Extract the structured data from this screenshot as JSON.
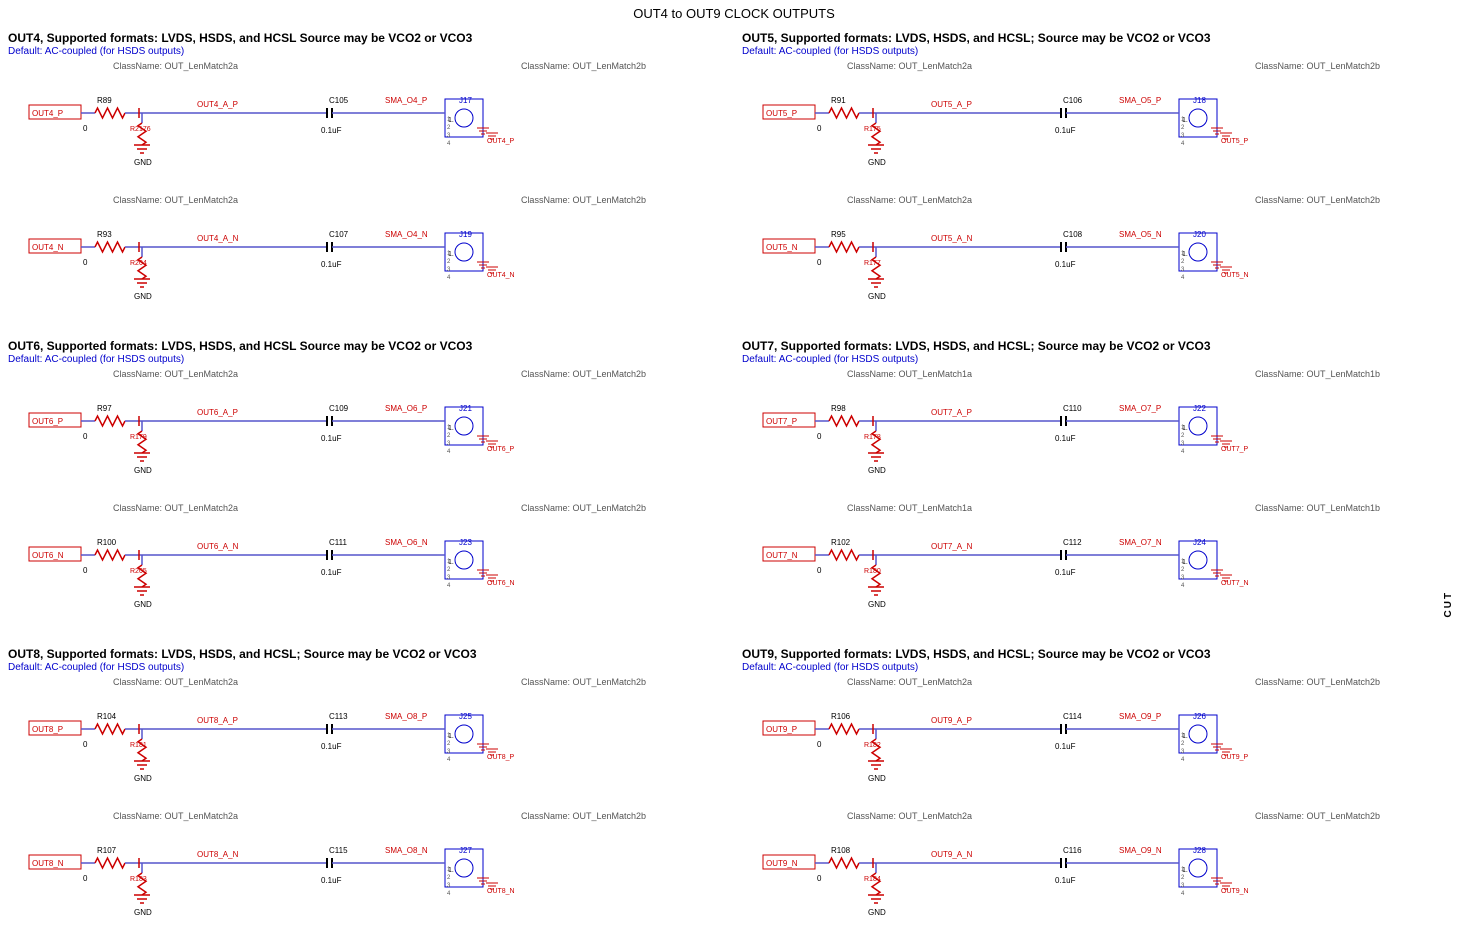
{
  "page": {
    "title": "OUT4 to OUT9 CLOCK OUTPUTS"
  },
  "sections": [
    {
      "id": "out4",
      "title": "OUT4, Supported  formats:  LVDS, HSDS, and HCSL Source  may be VCO2 or VCO3",
      "subtitle": "Default:  AC-coupled  (for HSDS outputs)",
      "circuits": [
        {
          "classLeft": "ClassName: OUT_LenMatch2a",
          "classRight": "ClassName: OUT_LenMatch2b",
          "net_in": "OUT4_P",
          "resistor1": "R89",
          "resistor2_label": "R2176",
          "net_mid": "OUT4_A_P",
          "cap": "C105",
          "cap_val": "0.1uF",
          "sma": "SMA_O4_P",
          "connector": "J17",
          "gnd": true
        },
        {
          "classLeft": "ClassName: OUT_LenMatch2a",
          "classRight": "ClassName: OUT_LenMatch2b",
          "net_in": "OUT4_N",
          "resistor1": "R93",
          "resistor2_label": "R204",
          "net_mid": "OUT4_A_N",
          "cap": "C107",
          "cap_val": "0.1uF",
          "sma": "SMA_O4_N",
          "connector": "J19",
          "gnd": true
        }
      ]
    },
    {
      "id": "out5",
      "title": "OUT5, Supported  formats:  LVDS, HSDS, and HCSL; Source  may be VCO2 or VCO3",
      "subtitle": "Default:  AC-coupled  (for HSDS outputs)",
      "circuits": [
        {
          "classLeft": "ClassName: OUT_LenMatch2a",
          "classRight": "ClassName: OUT_LenMatch2b",
          "net_in": "OUT5_P",
          "resistor1": "R91",
          "resistor2_label": "R175",
          "net_mid": "OUT5_A_P",
          "cap": "C106",
          "cap_val": "0.1uF",
          "sma": "SMA_O5_P",
          "connector": "J18",
          "gnd": true
        },
        {
          "classLeft": "ClassName: OUT_LenMatch2a",
          "classRight": "ClassName: OUT_LenMatch2b",
          "net_in": "OUT5_N",
          "resistor1": "R95",
          "resistor2_label": "R177",
          "net_mid": "OUT5_A_N",
          "cap": "C108",
          "cap_val": "0.1uF",
          "sma": "SMA_O5_N",
          "connector": "J20",
          "gnd": true
        }
      ]
    },
    {
      "id": "out6",
      "title": "OUT6, Supported  formats:  LVDS, HSDS, and HCSL Source  may be VCO2 or VCO3",
      "subtitle": "Default:  AC-coupled  (for HSDS outputs)",
      "circuits": [
        {
          "classLeft": "ClassName: OUT_LenMatch2a",
          "classRight": "ClassName: OUT_LenMatch2b",
          "net_in": "OUT6_P",
          "resistor1": "R97",
          "resistor2_label": "R179",
          "net_mid": "OUT6_A_P",
          "cap": "C109",
          "cap_val": "0.1uF",
          "sma": "SMA_O6_P",
          "connector": "J21",
          "gnd": true
        },
        {
          "classLeft": "ClassName: OUT_LenMatch2a",
          "classRight": "ClassName: OUT_LenMatch2b",
          "net_in": "OUT6_N",
          "resistor1": "R100",
          "resistor2_label": "R205",
          "net_mid": "OUT6_A_N",
          "cap": "C111",
          "cap_val": "0.1uF",
          "sma": "SMA_O6_N",
          "connector": "J23",
          "gnd": true
        }
      ]
    },
    {
      "id": "out7",
      "title": "OUT7, Supported  formats:  LVDS, HSDS, and HCSL; Source  may be VCO2 or VCO3",
      "subtitle": "Default:  AC-coupled  (for HSDS outputs)",
      "circuits": [
        {
          "classLeft": "ClassName: OUT_LenMatch1a",
          "classRight": "ClassName: OUT_LenMatch1b",
          "net_in": "OUT7_P",
          "resistor1": "R98",
          "resistor2_label": "R178",
          "net_mid": "OUT7_A_P",
          "cap": "C110",
          "cap_val": "0.1uF",
          "sma": "SMA_O7_P",
          "connector": "J22",
          "gnd": true
        },
        {
          "classLeft": "ClassName: OUT_LenMatch1a",
          "classRight": "ClassName: OUT_LenMatch1b",
          "net_in": "OUT7_N",
          "resistor1": "R102",
          "resistor2_label": "R180",
          "net_mid": "OUT7_A_N",
          "cap": "C112",
          "cap_val": "0.1uF",
          "sma": "SMA_O7_N",
          "connector": "J24",
          "gnd": true
        }
      ]
    },
    {
      "id": "out8",
      "title": "OUT8, Supported  formats:  LVDS, HSDS, and HCSL; Source  may be VCO2 or VCO3",
      "subtitle": "Default:  AC-coupled  (for HSDS outputs)",
      "circuits": [
        {
          "classLeft": "ClassName: OUT_LenMatch2a",
          "classRight": "ClassName: OUT_LenMatch2b",
          "net_in": "OUT8_P",
          "resistor1": "R104",
          "resistor2_label": "R181",
          "net_mid": "OUT8_A_P",
          "cap": "C113",
          "cap_val": "0.1uF",
          "sma": "SMA_O8_P",
          "connector": "J25",
          "gnd": true
        },
        {
          "classLeft": "ClassName: OUT_LenMatch2a",
          "classRight": "ClassName: OUT_LenMatch2b",
          "net_in": "OUT8_N",
          "resistor1": "R107",
          "resistor2_label": "R183",
          "net_mid": "OUT8_A_N",
          "cap": "C115",
          "cap_val": "0.1uF",
          "sma": "SMA_O8_N",
          "connector": "J27",
          "gnd": true
        }
      ]
    },
    {
      "id": "out9",
      "title": "OUT9, Supported  formats:  LVDS, HSDS, and HCSL; Source  may be VCO2 or VCO3",
      "subtitle": "Default:  AC-coupled  (for HSDS outputs)",
      "circuits": [
        {
          "classLeft": "ClassName: OUT_LenMatch2a",
          "classRight": "ClassName: OUT_LenMatch2b",
          "net_in": "OUT9_P",
          "resistor1": "R106",
          "resistor2_label": "R182",
          "net_mid": "OUT9_A_P",
          "cap": "C114",
          "cap_val": "0.1uF",
          "sma": "SMA_O9_P",
          "connector": "J26",
          "gnd": true
        },
        {
          "classLeft": "ClassName: OUT_LenMatch2a",
          "classRight": "ClassName: OUT_LenMatch2b",
          "net_in": "OUT9_N",
          "resistor1": "R108",
          "resistor2_label": "R184",
          "net_mid": "OUT9_A_N",
          "cap": "C116",
          "cap_val": "0.1uF",
          "sma": "SMA_O9_N",
          "connector": "J28",
          "gnd": true
        }
      ]
    }
  ],
  "cut_label": "CUT"
}
